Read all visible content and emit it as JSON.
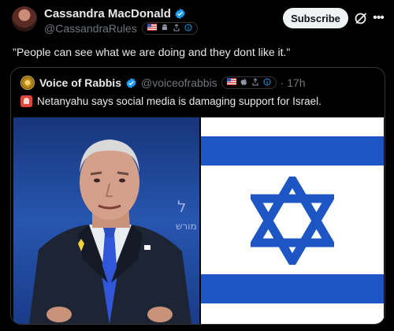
{
  "author": {
    "name": "Cassandra MacDonald",
    "handle": "@CassandraRules",
    "flair": [
      "flag-us-icon",
      "android-icon",
      "share-icon",
      "info-icon"
    ]
  },
  "actions": {
    "subscribe_label": "Subscribe"
  },
  "post": {
    "text": "\"People can see what we are doing and they dont like it.\""
  },
  "quote": {
    "name": "Voice of Rabbis",
    "handle": "@voiceofrabbis",
    "time": "· 17h",
    "text": "Netanyahu says social media is damaging support for Israel.",
    "flair": [
      "flag-us-icon",
      "apple-icon",
      "share-icon",
      "info-icon"
    ]
  },
  "media": {
    "left": "photo of Benjamin Netanyahu speaking at a podium",
    "right": "Israeli flag",
    "backdrop_text": "ל"
  },
  "colors": {
    "background": "#000000",
    "accent": "#1d9bf0",
    "flag_blue": "#1d56c4"
  }
}
